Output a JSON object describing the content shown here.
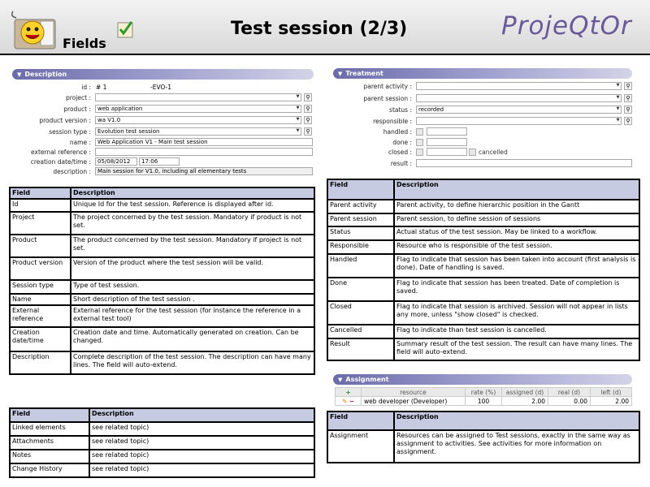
{
  "header": {
    "fields_label": "Fields",
    "title": "Test session (2/3)",
    "brand": "ProjeQtOr"
  },
  "description_section": {
    "title": "Description",
    "id_label": "id :",
    "id_value": "# 1",
    "reference": "-EVO-1",
    "project_label": "project :",
    "project_value": "",
    "product_label": "product :",
    "product_value": "web application",
    "product_version_label": "product version :",
    "product_version_value": "wa V1.0",
    "session_type_label": "session type :",
    "session_type_value": "Evolution test session",
    "name_label": "name :",
    "name_value": "Web Application V1 - Main test session",
    "external_reference_label": "external reference :",
    "external_reference_value": "",
    "creation_label": "creation date/time :",
    "creation_date": "05/08/2012",
    "creation_time": "17:06",
    "description_label": "description :",
    "description_value": "Main session for V1.0, including all elementary tests"
  },
  "treatment_section": {
    "title": "Treatment",
    "parent_activity_label": "parent activity :",
    "parent_activity_value": "",
    "parent_session_label": "parent session :",
    "parent_session_value": "",
    "status_label": "status :",
    "status_value": "recorded",
    "responsible_label": "responsible :",
    "responsible_value": "",
    "handled_label": "handled :",
    "done_label": "done :",
    "closed_label": "closed :",
    "cancelled_label": "cancelled",
    "result_label": "result :"
  },
  "table_left_1": {
    "headers": [
      "Field",
      "Description"
    ],
    "rows": [
      [
        "Id",
        "Unique Id for the test session. Reference is displayed after id."
      ],
      [
        "Project",
        "The project concerned by the test session. Mandatory if product is not set."
      ],
      [
        "Product",
        "The product concerned by the test session. Mandatory if project is not set."
      ],
      [
        "Product version",
        "Version of the product where the test session will be valid."
      ],
      [
        "Session type",
        "Type of test session."
      ],
      [
        "Name",
        "Short description of the test session ."
      ],
      [
        "External reference",
        "External reference for the test session (for instance the reference in a external test tool)"
      ],
      [
        "Creation date/time",
        "Creation date and time. Automatically generated on creation. Can be changed."
      ],
      [
        "Description",
        "Complete description of the test session. The description can have many lines. The field will auto-extend."
      ]
    ]
  },
  "table_left_2": {
    "headers": [
      "Field",
      "Description"
    ],
    "rows": [
      [
        "Linked elements",
        "see related topic)"
      ],
      [
        "Attachments",
        "see related topic)"
      ],
      [
        "Notes",
        "see related topic)"
      ],
      [
        "Change History",
        "see related topic)"
      ]
    ]
  },
  "table_right_1": {
    "headers": [
      "Field",
      "Description"
    ],
    "rows": [
      [
        "Parent activity",
        "Parent activity, to define hierarchic position in the Gantt"
      ],
      [
        "Parent session",
        "Parent session, to define session of sessions"
      ],
      [
        "Status",
        "Actual status of the test session. May be linked to a workflow."
      ],
      [
        "Responsible",
        "Resource who is responsible of the test session."
      ],
      [
        "Handled",
        "Flag to indicate that session has been taken into account (first analysis is done). Date of handling is saved."
      ],
      [
        "Done",
        "Flag to indicate that session has been treated. Date of completion is saved."
      ],
      [
        "Closed",
        "Flag to indicate that session is archived. Session will not appear in lists any more, unless \"show closed\" is checked."
      ],
      [
        "Cancelled",
        "Flag to indicate than test session is cancelled."
      ],
      [
        "Result",
        "Summary result of the test session. The result can have many lines. The field will auto-extend."
      ]
    ]
  },
  "assignment_section": {
    "title": "Assignment",
    "headers": [
      "resource",
      "rate (%)",
      "assigned (d)",
      "real (d)",
      "left (d)"
    ],
    "row": [
      "web developer (Developer)",
      "100",
      "2.00",
      "0.00",
      "2.00"
    ]
  },
  "table_right_2": {
    "headers": [
      "Field",
      "Description"
    ],
    "rows": [
      [
        "Assignment",
        "Resources can be assigned to Test sessions, exactly in the same way as assignment to activities. See activities for more information on assignment."
      ]
    ]
  },
  "colors": {
    "section_bar": "#6b6bab",
    "table_header": "#c7cbe2",
    "brand": "#6a5a9a"
  }
}
